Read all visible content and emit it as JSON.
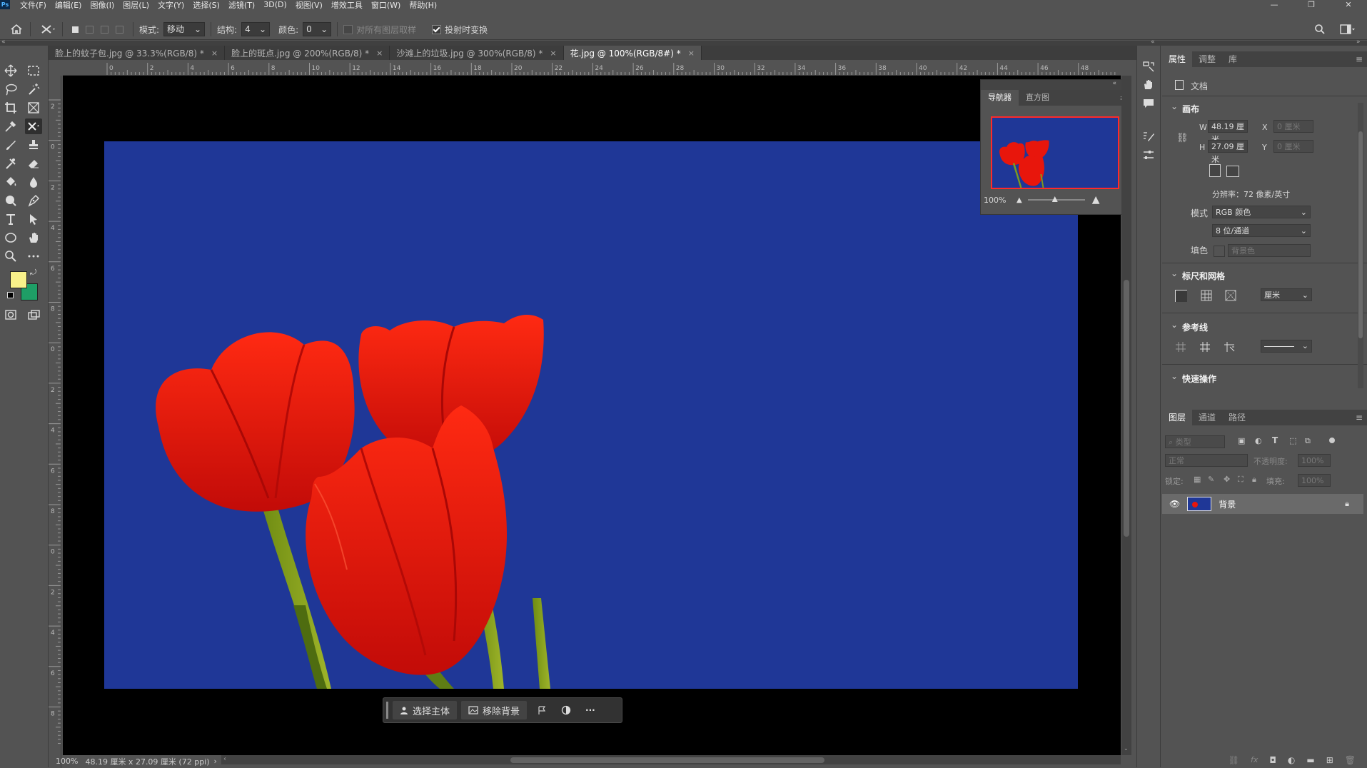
{
  "app": {
    "logo": "Ps"
  },
  "menu": [
    "文件(F)",
    "编辑(E)",
    "图像(I)",
    "图层(L)",
    "文字(Y)",
    "选择(S)",
    "滤镜(T)",
    "3D(D)",
    "视图(V)",
    "增效工具",
    "窗口(W)",
    "帮助(H)"
  ],
  "window_controls": {
    "minimize": "—",
    "restore": "❐",
    "close": "✕"
  },
  "options": {
    "mode_label": "模式:",
    "mode_value": "移动",
    "structure_label": "结构:",
    "structure_value": "4",
    "color_label": "颜色:",
    "color_value": "0",
    "sample_all_label": "对所有图层取样",
    "transform_label": "投射时变换"
  },
  "tabs": [
    {
      "label": "脸上的蚊子包.jpg @ 33.3%(RGB/8) *",
      "close": "×"
    },
    {
      "label": "脸上的斑点.jpg @ 200%(RGB/8) *",
      "close": "×"
    },
    {
      "label": "沙滩上的垃圾.jpg @ 300%(RGB/8) *",
      "close": "×"
    },
    {
      "label": "花.jpg @ 100%(RGB/8#) *",
      "close": "×"
    }
  ],
  "ruler": {
    "h_ticks": [
      "0",
      "2",
      "4",
      "6",
      "8",
      "10",
      "12",
      "14",
      "16",
      "18",
      "20",
      "22",
      "24",
      "26",
      "28",
      "30",
      "32",
      "34",
      "36",
      "38",
      "40",
      "42",
      "44",
      "46",
      "48"
    ],
    "v_ticks": [
      "2",
      "0",
      "2",
      "4",
      "6",
      "8",
      "0",
      "2",
      "4",
      "6",
      "8",
      "0",
      "2",
      "4",
      "6",
      "8"
    ]
  },
  "status": {
    "zoom": "100%",
    "doc_size": "48.19 厘米 x 27.09 厘米 (72 ppi)",
    "arrow": "›",
    "left_arrow": "‹"
  },
  "taskbar": {
    "select_subject": "选择主体",
    "remove_bg": "移除背景",
    "more": "···"
  },
  "navigator": {
    "tab_navigator": "导航器",
    "tab_histogram": "直方图",
    "zoom": "100%"
  },
  "properties": {
    "tabs": [
      "属性",
      "调整",
      "库"
    ],
    "doc_label": "文档",
    "canvas_section": "画布",
    "w_label": "W",
    "w_value": "48.19 厘米",
    "h_label": "H",
    "h_value": "27.09 厘米",
    "x_label": "X",
    "x_value": "0 厘米",
    "y_label": "Y",
    "y_value": "0 厘米",
    "resolution": "分辨率：72 像素/英寸",
    "mode_label": "模式",
    "mode_value": "RGB 颜色",
    "depth_value": "8 位/通道",
    "fill_label": "填色",
    "fill_value": "背景色",
    "rulers_section": "标尺和网格",
    "units_value": "厘米",
    "guides_section": "参考线",
    "quick_section": "快速操作"
  },
  "layers": {
    "tabs": [
      "图层",
      "通道",
      "路径"
    ],
    "filter_placeholder": "类型",
    "blend_mode": "正常",
    "opacity_label": "不透明度:",
    "opacity_value": "100%",
    "lock_label": "锁定:",
    "fill_label": "填充:",
    "fill_value": "100%",
    "items": [
      {
        "name": "背景"
      }
    ]
  },
  "colors": {
    "foreground": "#f9f18a",
    "background": "#1e9e66",
    "doc_bg": "#1f3797"
  }
}
